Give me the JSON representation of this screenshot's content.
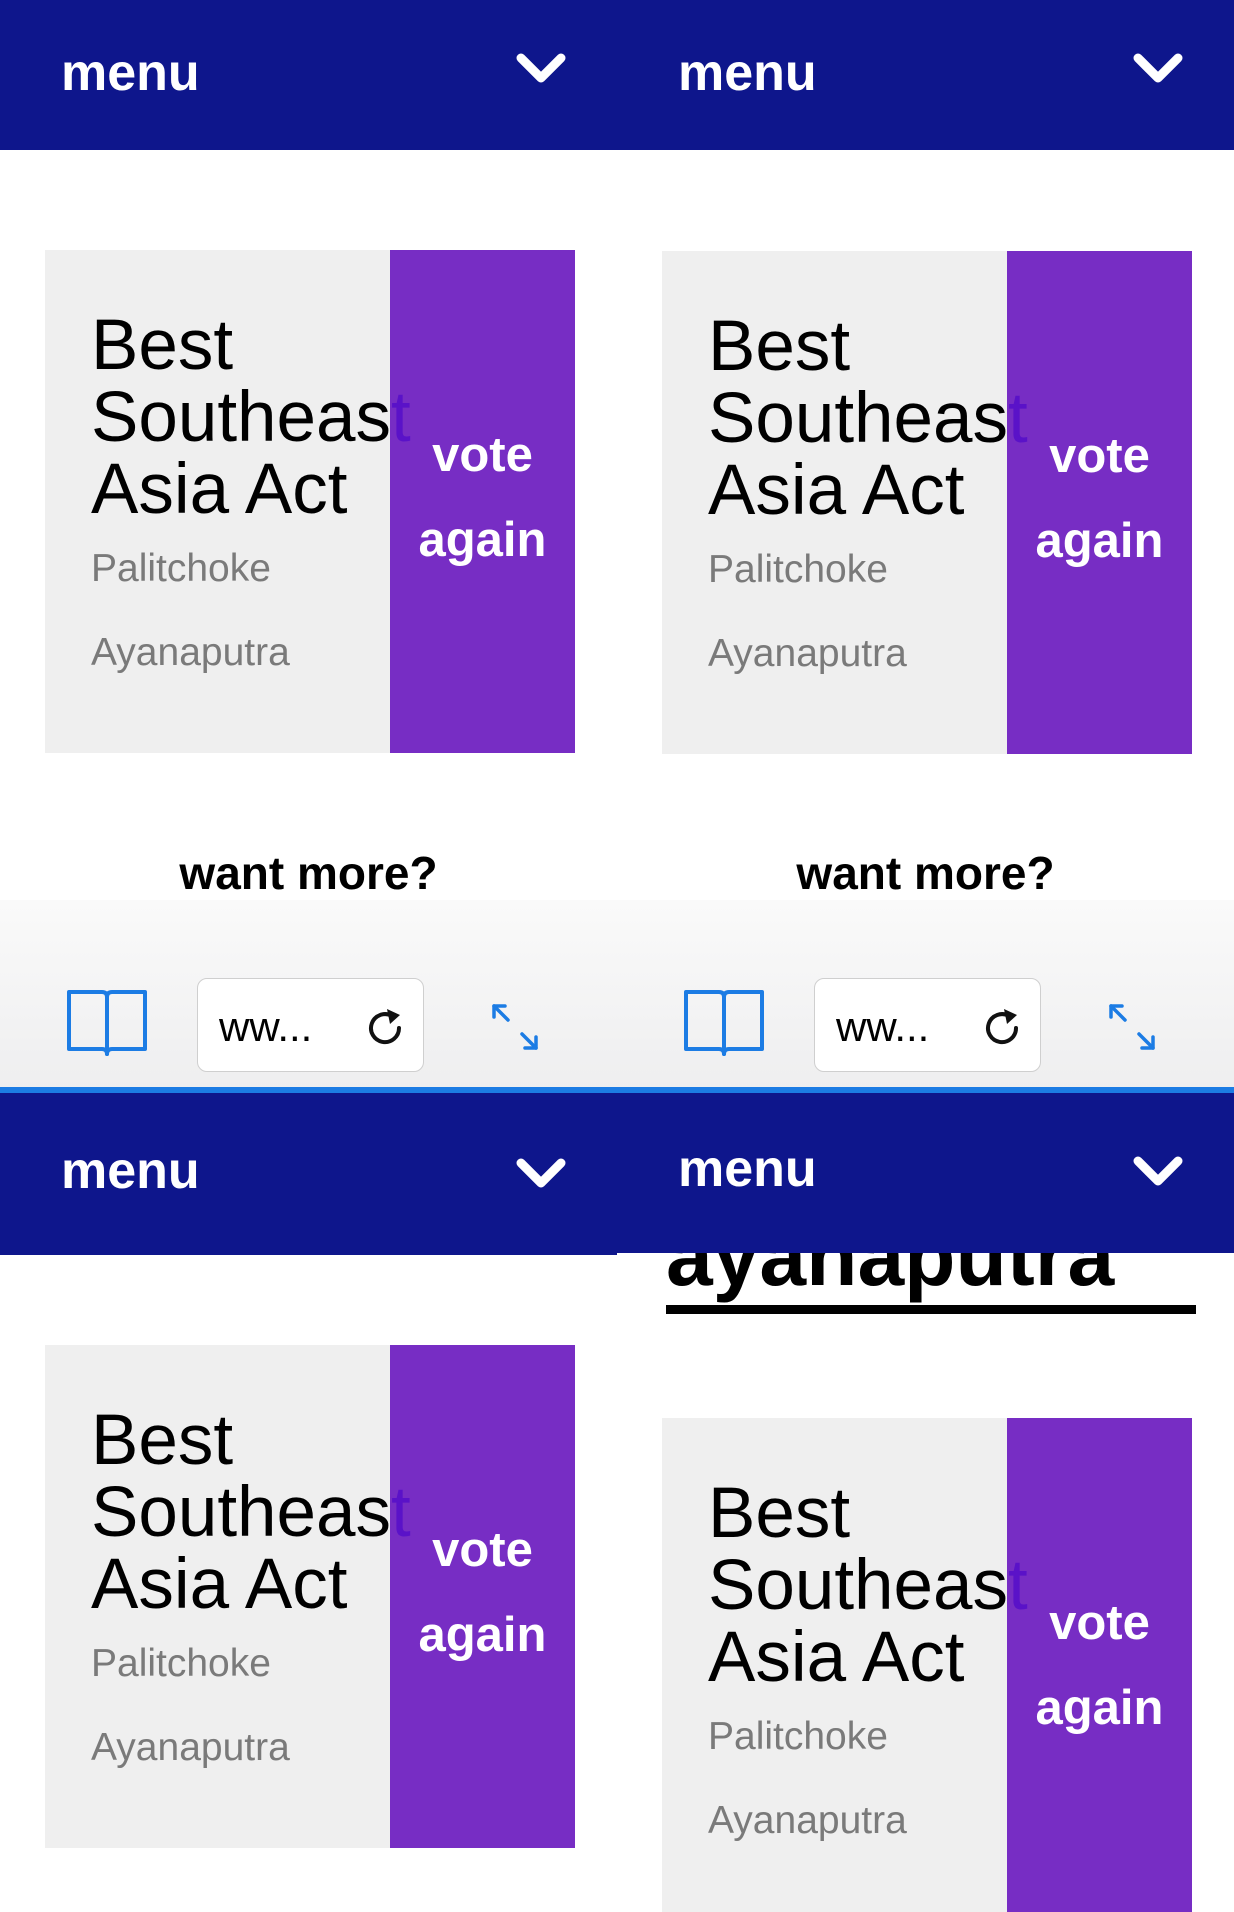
{
  "menu": {
    "label": "menu"
  },
  "card": {
    "title_line1": "Best",
    "title_line2_main": "Southeas",
    "title_line2_end": "t",
    "title_line3": "Asia Act",
    "subtitle_line1": "Palitchoke",
    "subtitle_line2": "Ayanaputra",
    "vote_line1": "vote",
    "vote_line2": "again"
  },
  "want_more": "want more?",
  "browser": {
    "url": "ww..."
  },
  "scrolled_heading": "ayanaputra",
  "colors": {
    "menu_bg": "#0e168c",
    "vote_bg": "#772dc4",
    "card_bg": "#efefef",
    "accent_blue": "#1c7ce4"
  },
  "icons": {
    "menu": "chevron-down-icon",
    "bookmarks": "book-icon",
    "reload": "reload-icon",
    "fullscreen": "expand-icon"
  }
}
